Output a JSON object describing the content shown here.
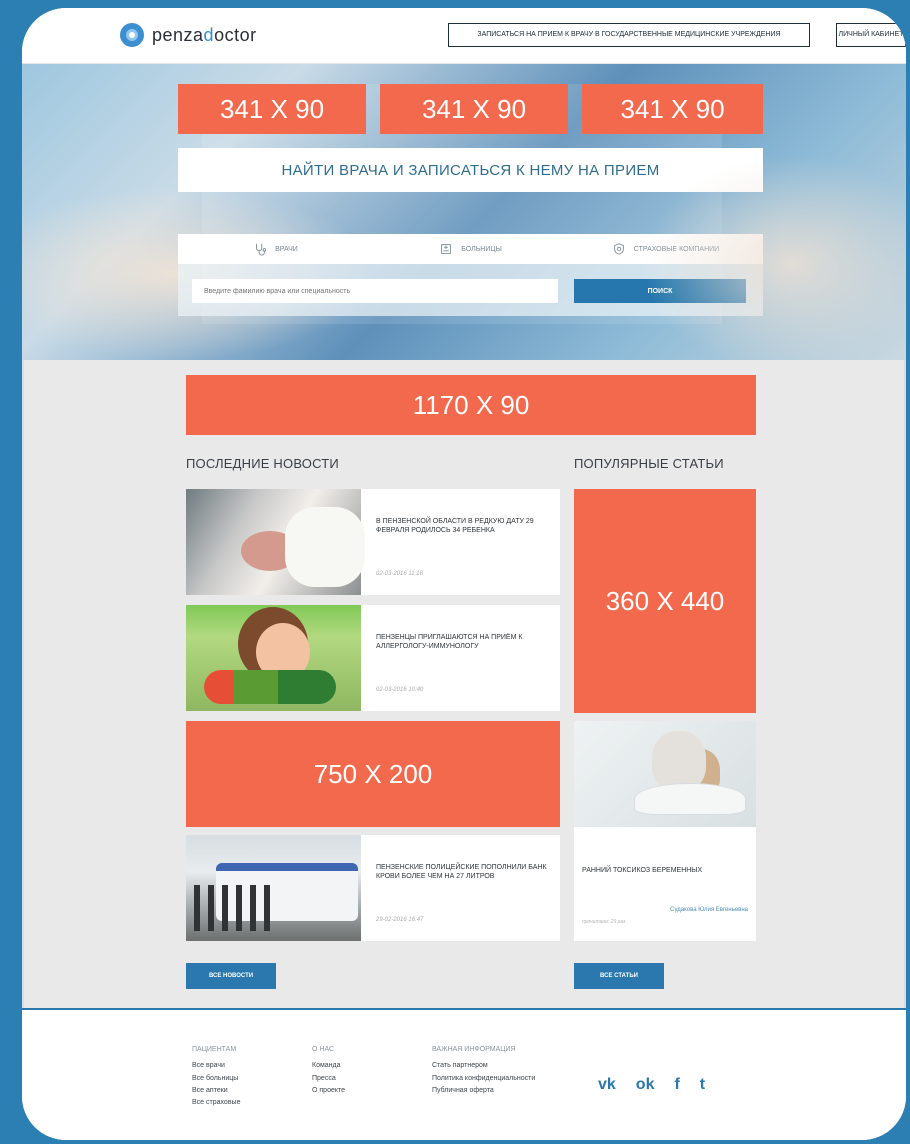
{
  "header": {
    "logo_prefix": "penza",
    "logo_mark": "d",
    "logo_suffix": "octor",
    "cta": "ЗАПИСАТЬСЯ НА ПРИЕМ К ВРАЧУ В ГОСУДАРСТВЕННЫЕ МЕДИЦИНСКИЕ УЧРЕЖДЕНИЯ",
    "account": "ЛИЧНЫЙ КАБИНЕТ"
  },
  "hero": {
    "ads": [
      "341 X 90",
      "341 X 90",
      "341 X 90"
    ],
    "title": "НАЙТИ ВРАЧА И ЗАПИСАТЬСЯ К НЕМУ НА ПРИЕМ",
    "tabs": [
      {
        "label": "ВРАЧИ",
        "icon": "stethoscope-icon"
      },
      {
        "label": "БОЛЬНИЦЫ",
        "icon": "hospital-icon"
      },
      {
        "label": "СТРАХОВЫЕ КОМПАНИИ",
        "icon": "shield-icon"
      }
    ],
    "search_placeholder": "Введите фамилию врача или специальность",
    "search_button": "ПОИСК"
  },
  "banners": {
    "wide": "1170 X 90",
    "side": "360 X 440",
    "middle": "750 X 200"
  },
  "sections": {
    "news_title": "ПОСЛЕДНИЕ НОВОСТИ",
    "articles_title": "ПОПУЛЯРНЫЕ СТАТЬИ"
  },
  "news": [
    {
      "title": "В ПЕНЗЕНСКОЙ ОБЛАСТИ В РЕДКУЮ ДАТУ 29 ФЕВРАЛЯ РОДИЛОСЬ 34 РЕБЕНКА",
      "date": "02-03-2016 11:18"
    },
    {
      "title": "ПЕНЗЕНЦЫ ПРИГЛАШАЮТСЯ НА ПРИЁМ К АЛЛЕРГОЛОГУ-ИММУНОЛОГУ",
      "date": "02-03-2016 10:40"
    },
    {
      "title": "ПЕНЗЕНСКИЕ ПОЛИЦЕЙСКИЕ ПОПОЛНИЛИ БАНК КРОВИ БОЛЕЕ ЧЕМ НА 27 ЛИТРОВ",
      "date": "29-02-2016 16:47"
    }
  ],
  "article": {
    "title": "РАННИЙ ТОКСИКОЗ БЕРЕМЕННЫХ",
    "author": "Судакова Юлия Евгеньевна",
    "views": "прочитано: 29 раз"
  },
  "buttons": {
    "all_news": "ВСЕ НОВОСТИ",
    "all_articles": "ВСЕ СТАТЬИ"
  },
  "footer": {
    "patients": {
      "title": "ПАЦИЕНТАМ",
      "items": [
        "Все врачи",
        "Все больницы",
        "Все аптеки",
        "Все страховые"
      ]
    },
    "about": {
      "title": "О НАС",
      "items": [
        "Команда",
        "Пресса",
        "О проекте"
      ]
    },
    "important": {
      "title": "ВАЖНАЯ ИНФОРМАЦИЯ",
      "items": [
        "Стать партнером",
        "Политика конфиденциальности",
        "Публичная оферта"
      ]
    },
    "social": [
      "vk-icon",
      "odnoklassniki-icon",
      "facebook-icon",
      "twitter-icon"
    ]
  }
}
